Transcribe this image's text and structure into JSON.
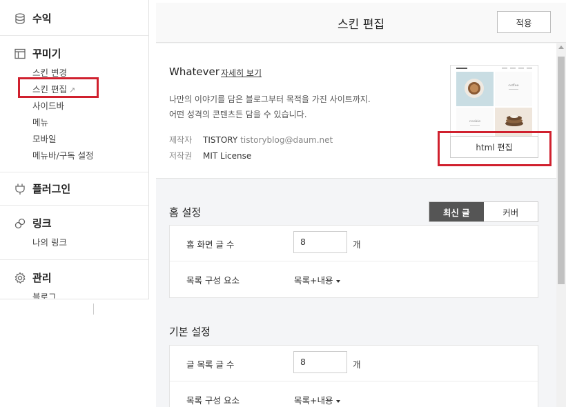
{
  "sidebar": {
    "revenue": {
      "label": "수익"
    },
    "decorate": {
      "label": "꾸미기",
      "items": [
        "스킨 변경",
        "스킨 편집",
        "사이드바",
        "메뉴",
        "모바일",
        "메뉴바/구독 설정"
      ]
    },
    "plugin": {
      "label": "플러그인"
    },
    "link": {
      "label": "링크",
      "items": [
        "나의 링크"
      ]
    },
    "manage": {
      "label": "관리",
      "items": [
        "블로그"
      ]
    }
  },
  "header": {
    "title": "스킨 편집",
    "apply_label": "적용"
  },
  "skin": {
    "name": "Whatever",
    "detail_link": "자세히 보기",
    "desc_line1": "나만의 이야기를 담은 블로그부터 목적을 가진 사이트까지.",
    "desc_line2": "어떤 성격의 콘텐츠든 담을 수 있습니다.",
    "maker_key": "제작자",
    "maker_name": "TISTORY",
    "maker_email": "tistoryblog@daum.net",
    "license_key": "저작권",
    "license_value": "MIT License",
    "html_edit_label": "html 편집",
    "thumb_coffee": "coffee",
    "thumb_cookie": "cookie"
  },
  "home_settings": {
    "title": "홈 설정",
    "toggle": [
      "최신 글",
      "커버"
    ],
    "active_toggle": "최신 글",
    "rows": {
      "count_label": "홈 화면 글 수",
      "count_value": "8",
      "count_unit": "개",
      "compose_label": "목록 구성 요소",
      "compose_value": "목록+내용"
    }
  },
  "basic_settings": {
    "title": "기본 설정",
    "rows": {
      "count_label": "글 목록 글 수",
      "count_value": "8",
      "count_unit": "개",
      "compose_label": "목록 구성 요소",
      "compose_value": "목록+내용"
    }
  },
  "colors": {
    "highlight": "#d0202e",
    "toggle_active": "#555555",
    "background": "#f4f5f7"
  }
}
